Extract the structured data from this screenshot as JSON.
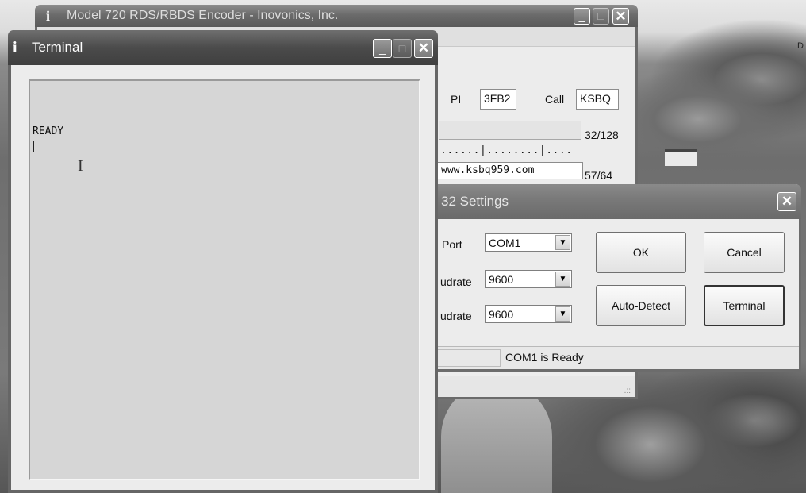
{
  "desktop": {
    "edge_letter": "D"
  },
  "main_window": {
    "title": "Model 720 RDS/RBDS Encoder - Inovonics, Inc.",
    "pi_label": "PI",
    "pi_value": "3FB2",
    "call_label": "Call",
    "call_value": "KSBQ",
    "count1": "32/128",
    "ruler": "......|........|....",
    "text_value": "www.ksbq959.com",
    "count2": "57/64",
    "resize_grip": ".::"
  },
  "settings_dialog": {
    "title": "32 Settings",
    "port_label": "Port",
    "port_value": "COM1",
    "baud1_label": "udrate",
    "baud1_value": "9600",
    "baud2_label": "udrate",
    "baud2_value": "9600",
    "ok_label": "OK",
    "cancel_label": "Cancel",
    "autodetect_label": "Auto-Detect",
    "terminal_label": "Terminal",
    "status_text": "COM1 is Ready"
  },
  "terminal_window": {
    "title": "Terminal",
    "output_line": "READY"
  }
}
